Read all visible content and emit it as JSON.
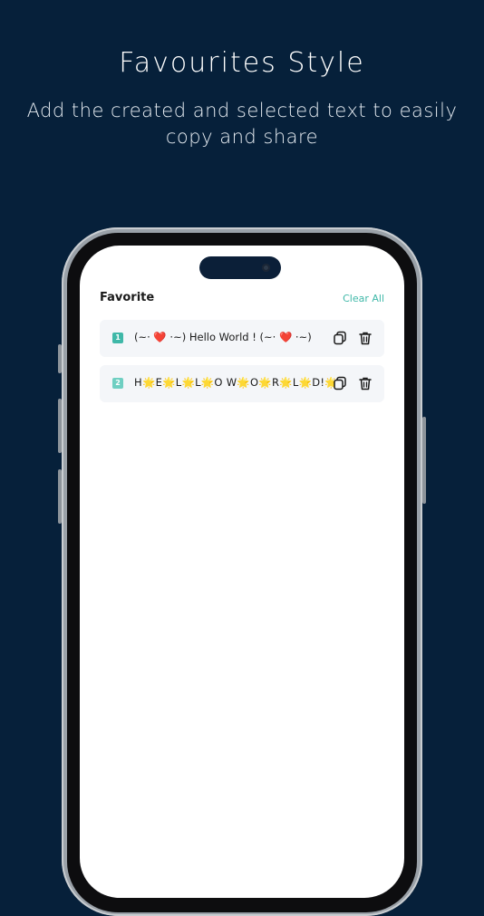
{
  "promo": {
    "title": "Favourites Style",
    "subtitle": "Add the created and selected text to easily copy and share"
  },
  "screen": {
    "header_title": "Favorite",
    "clear_all_label": "Clear All",
    "items": [
      {
        "index": "1",
        "text": "(~· ❤️ ·~) Hello World ! (~· ❤️ ·~)"
      },
      {
        "index": "2",
        "text": "H🌟E🌟L🌟L🌟O W🌟O🌟R🌟L🌟D!🌟"
      }
    ]
  },
  "colors": {
    "background": "#06203a",
    "accent": "#3fb8a8"
  }
}
